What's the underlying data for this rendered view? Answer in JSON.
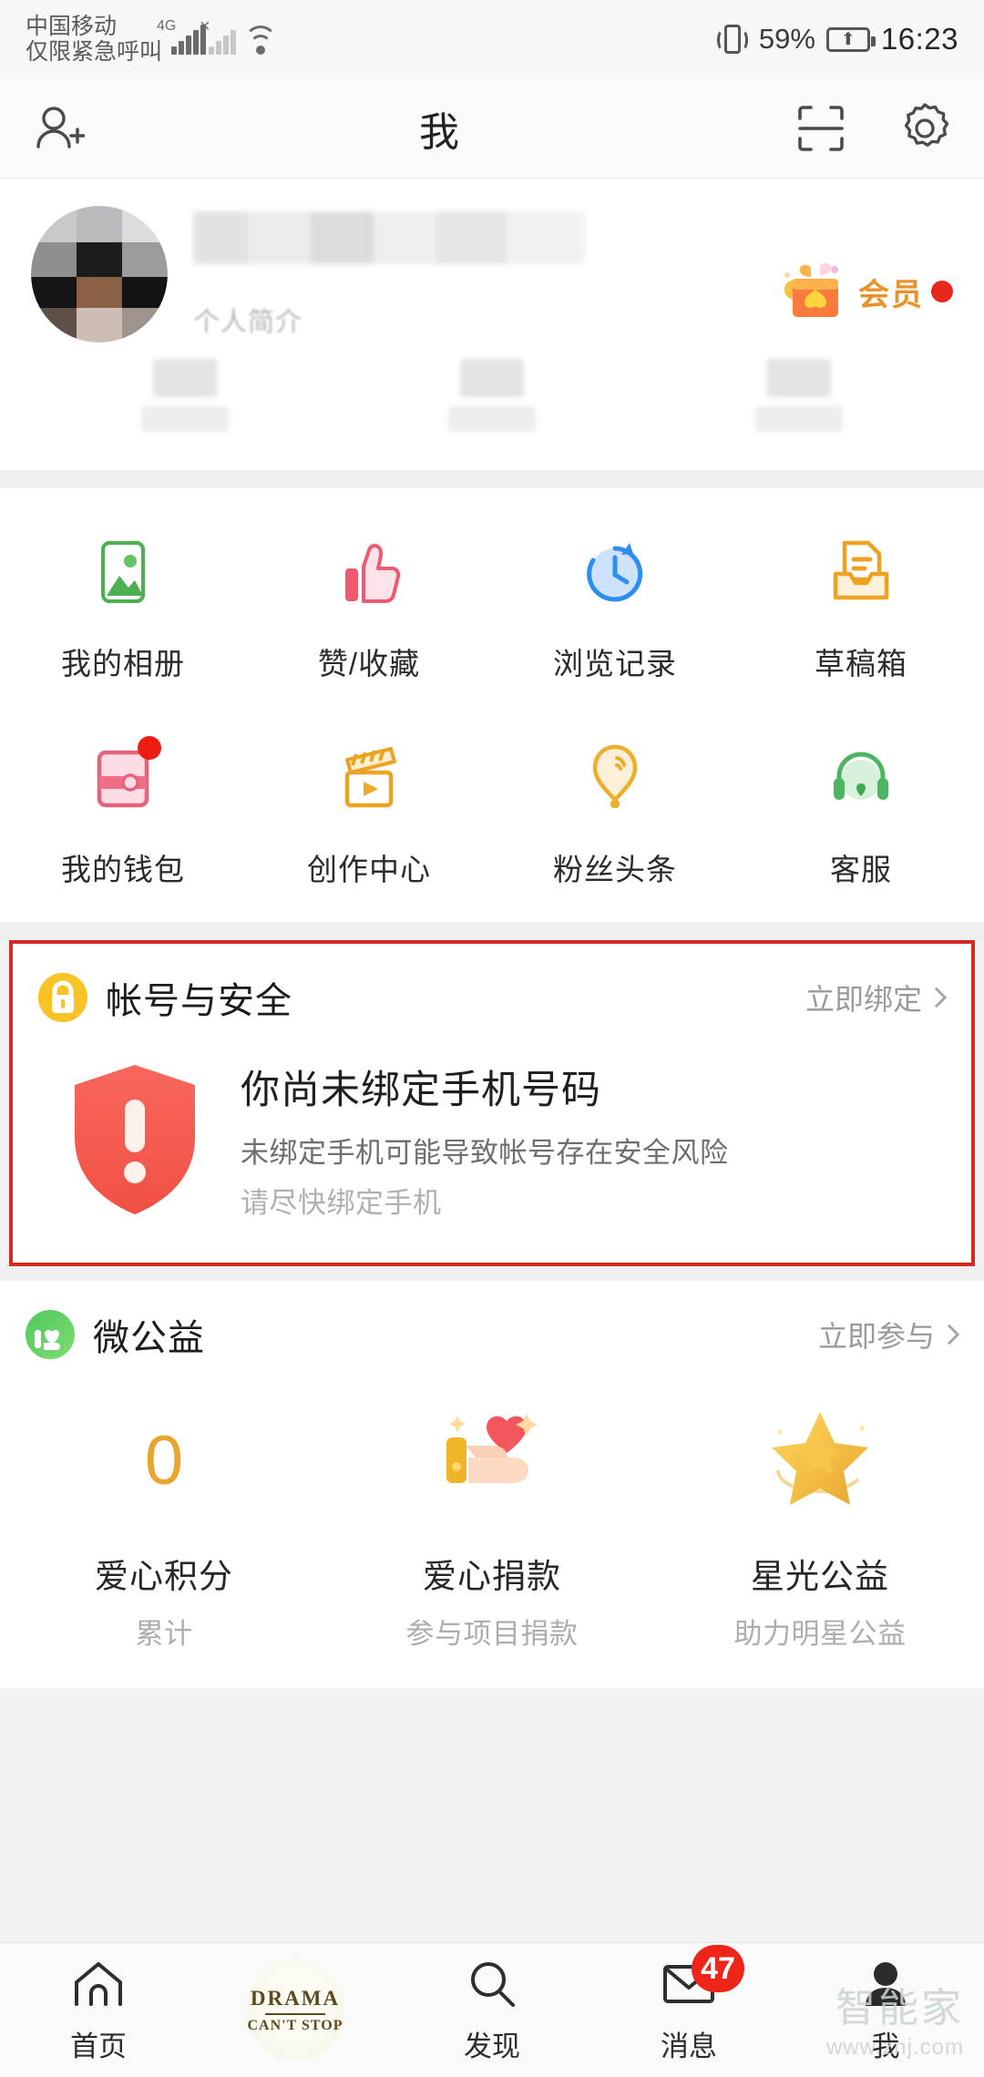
{
  "status_bar": {
    "carrier_line1": "中国移动",
    "carrier_line2": "仅限紧急呼叫",
    "network": "4G",
    "sim2_marker": "×",
    "wifi_icon": "wifi-icon",
    "vibrate_icon": "vibrate-icon",
    "battery_percent": "59%",
    "charging_icon": "charging-bolt-icon",
    "time": "16:23"
  },
  "header": {
    "add_friend_icon": "add-friend-icon",
    "title": "我",
    "scan_icon": "scan-qr-icon",
    "settings_icon": "gear-icon"
  },
  "profile": {
    "avatar": "user-avatar",
    "name": "",
    "bio": "个人简介",
    "vip_label": "会员",
    "vip_dot": true,
    "stats": [
      {
        "value": "",
        "label": ""
      },
      {
        "value": "",
        "label": ""
      },
      {
        "value": "",
        "label": ""
      }
    ]
  },
  "grid": {
    "rows": [
      [
        {
          "label": "我的相册",
          "icon": "photo-album-icon",
          "badge": false
        },
        {
          "label": "赞/收藏",
          "icon": "thumbs-up-icon",
          "badge": false
        },
        {
          "label": "浏览记录",
          "icon": "history-clock-icon",
          "badge": false
        },
        {
          "label": "草稿箱",
          "icon": "draft-box-icon",
          "badge": false
        }
      ],
      [
        {
          "label": "我的钱包",
          "icon": "wallet-icon",
          "badge": true
        },
        {
          "label": "创作中心",
          "icon": "clapperboard-icon",
          "badge": false
        },
        {
          "label": "粉丝头条",
          "icon": "balloon-icon",
          "badge": false
        },
        {
          "label": "客服",
          "icon": "headset-icon",
          "badge": false
        }
      ]
    ]
  },
  "security": {
    "icon": "lock-icon",
    "title": "帐号与安全",
    "action": "立即绑定",
    "chevron": "chevron-right-icon",
    "alert_icon": "shield-warning-icon",
    "headline": "你尚未绑定手机号码",
    "detail": "未绑定手机可能导致帐号存在安全风险",
    "hint": "请尽快绑定手机",
    "highlight_color": "#d32b20"
  },
  "charity": {
    "icon": "charity-hand-heart-icon",
    "title": "微公益",
    "action": "立即参与",
    "chevron": "chevron-right-icon",
    "items": [
      {
        "icon": "zero-value",
        "value": "0",
        "label": "爱心积分",
        "sub": "累计"
      },
      {
        "icon": "hand-heart-icon",
        "value": "",
        "label": "爱心捐款",
        "sub": "参与项目捐款"
      },
      {
        "icon": "gold-star-icon",
        "value": "",
        "label": "星光公益",
        "sub": "助力明星公益"
      }
    ]
  },
  "tabbar": {
    "tabs": [
      {
        "label": "首页",
        "icon": "home-icon",
        "badge": "",
        "active": false
      },
      {
        "label": "",
        "icon": "drama-promo-icon",
        "badge": "",
        "active": false,
        "promo_line1": "DRAMA",
        "promo_line2": "CAN'T STOP"
      },
      {
        "label": "发现",
        "icon": "search-icon",
        "badge": "",
        "active": false
      },
      {
        "label": "消息",
        "icon": "envelope-icon",
        "badge": "47",
        "active": false
      },
      {
        "label": "我",
        "icon": "person-icon",
        "badge": "",
        "active": true
      }
    ]
  },
  "watermark": {
    "line1": "智能家",
    "line2": "www.znj.com"
  }
}
